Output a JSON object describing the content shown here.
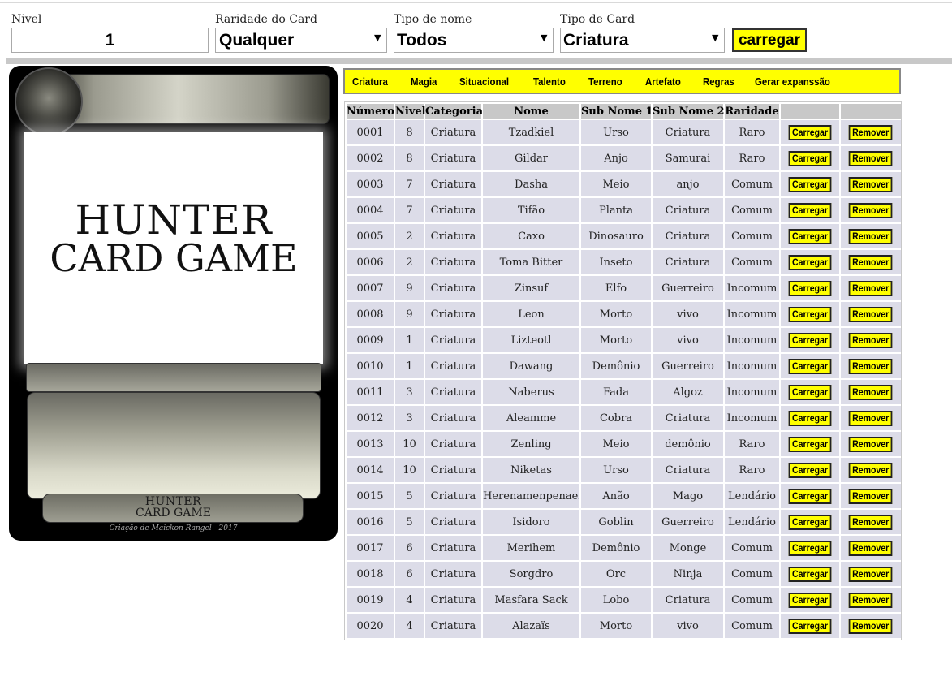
{
  "controls": {
    "nivel_label": "Nivel",
    "nivel_value": "1",
    "raridade_label": "Raridade do Card",
    "raridade_value": "Qualquer",
    "tipo_nome_label": "Tipo de nome",
    "tipo_nome_value": "Todos",
    "tipo_card_label": "Tipo de Card",
    "tipo_card_value": "Criatura",
    "load_button": "carregar",
    "dropdown_icon": "chevron-down-icon"
  },
  "card": {
    "title_line1": "HUNTER",
    "title_line2": "CARD GAME",
    "logo_line1": "HUNTER",
    "logo_line2": "CARD GAME",
    "credit": "Criação de Maickon Rangel - 2017"
  },
  "nav": {
    "items": [
      "Criatura",
      "Magia",
      "Situacional",
      "Talento",
      "Terreno",
      "Artefato",
      "Regras",
      "Gerar expanssão"
    ]
  },
  "table": {
    "headers": [
      "Número",
      "Nivel",
      "Categoria",
      "Nome",
      "Sub Nome 1",
      "Sub Nome 2",
      "Raridade",
      "",
      ""
    ],
    "load_label": "Carregar",
    "remove_label": "Remover",
    "rows": [
      [
        "0001",
        "8",
        "Criatura",
        "Tzadkiel",
        "Urso",
        "Criatura",
        "Raro"
      ],
      [
        "0002",
        "8",
        "Criatura",
        "Gildar",
        "Anjo",
        "Samurai",
        "Raro"
      ],
      [
        "0003",
        "7",
        "Criatura",
        "Dasha",
        "Meio",
        "anjo",
        "Comum"
      ],
      [
        "0004",
        "7",
        "Criatura",
        "Tifão",
        "Planta",
        "Criatura",
        "Comum"
      ],
      [
        "0005",
        "2",
        "Criatura",
        "Caxo",
        "Dinosauro",
        "Criatura",
        "Comum"
      ],
      [
        "0006",
        "2",
        "Criatura",
        "Toma Bitter",
        "Inseto",
        "Criatura",
        "Comum"
      ],
      [
        "0007",
        "9",
        "Criatura",
        "Zinsuf",
        "Elfo",
        "Guerreiro",
        "Incomum"
      ],
      [
        "0008",
        "9",
        "Criatura",
        "Leon",
        "Morto",
        "vivo",
        "Incomum"
      ],
      [
        "0009",
        "1",
        "Criatura",
        "Lizteotl",
        "Morto",
        "vivo",
        "Incomum"
      ],
      [
        "0010",
        "1",
        "Criatura",
        "Dawang",
        "Demônio",
        "Guerreiro",
        "Incomum"
      ],
      [
        "0011",
        "3",
        "Criatura",
        "Naberus",
        "Fada",
        "Algoz",
        "Incomum"
      ],
      [
        "0012",
        "3",
        "Criatura",
        "Aleamme",
        "Cobra",
        "Criatura",
        "Incomum"
      ],
      [
        "0013",
        "10",
        "Criatura",
        "Zenling",
        "Meio",
        "demônio",
        "Raro"
      ],
      [
        "0014",
        "10",
        "Criatura",
        "Niketas",
        "Urso",
        "Criatura",
        "Raro"
      ],
      [
        "0015",
        "5",
        "Criatura",
        "Herenamenpenaef",
        "Anão",
        "Mago",
        "Lendário"
      ],
      [
        "0016",
        "5",
        "Criatura",
        "Isidoro",
        "Goblin",
        "Guerreiro",
        "Lendário"
      ],
      [
        "0017",
        "6",
        "Criatura",
        "Merihem",
        "Demônio",
        "Monge",
        "Comum"
      ],
      [
        "0018",
        "6",
        "Criatura",
        "Sorgdro",
        "Orc",
        "Ninja",
        "Comum"
      ],
      [
        "0019",
        "4",
        "Criatura",
        "Masfara Sack",
        "Lobo",
        "Criatura",
        "Comum"
      ],
      [
        "0020",
        "4",
        "Criatura",
        "Alazaïs",
        "Morto",
        "vivo",
        "Comum"
      ]
    ]
  }
}
